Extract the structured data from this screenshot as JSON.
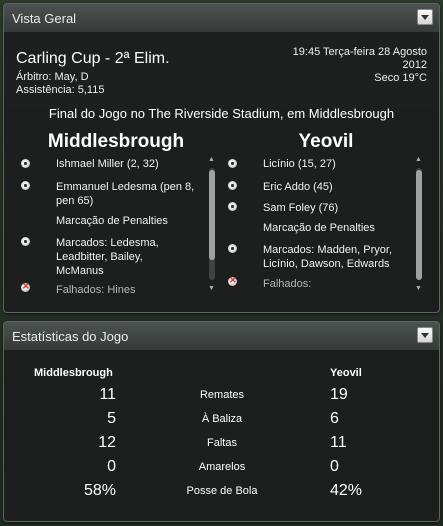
{
  "overview": {
    "title": "Vista Geral",
    "competition": "Carling Cup - 2ª Elim.",
    "referee": "Árbitro: May, D",
    "attendance": "Assistência: 5,115",
    "datetime_line1": "19:45 Terça-feira 28 Agosto",
    "datetime_line2": "2012",
    "weather": "Seco 19°C",
    "venue": "Final do Jogo no The Riverside Stadium, em Middlesbrough"
  },
  "home": {
    "name": "Middlesbrough",
    "goals": [
      "Ishmael Miller (2, 32)",
      "Emmanuel Ledesma (pen 8,",
      "pen 65)"
    ],
    "penalties_title": "Marcação de Penalties",
    "scored": [
      "Marcados: Ledesma,",
      "Leadbitter, Bailey,",
      "McManus"
    ],
    "missed": "Falhados: Hines"
  },
  "away": {
    "name": "Yeovil",
    "goals": [
      "Licínio (15, 27)",
      "Eric Addo (45)",
      "Sam Foley (76)"
    ],
    "penalties_title": "Marcação de Penalties",
    "scored": [
      "Marcados: Madden, Pryor,",
      "Licínio, Dawson, Edwards"
    ],
    "missed": "Falhados:"
  },
  "stats": {
    "title": "Estatísticas do Jogo",
    "home_team": "Middlesbrough",
    "away_team": "Yeovil",
    "rows": [
      {
        "label": "Remates",
        "home": "11",
        "away": "19"
      },
      {
        "label": "À Baliza",
        "home": "5",
        "away": "6"
      },
      {
        "label": "Faltas",
        "home": "12",
        "away": "11"
      },
      {
        "label": "Amarelos",
        "home": "0",
        "away": "0"
      },
      {
        "label": "Posse de Bola",
        "home": "58%",
        "away": "42%"
      }
    ]
  }
}
